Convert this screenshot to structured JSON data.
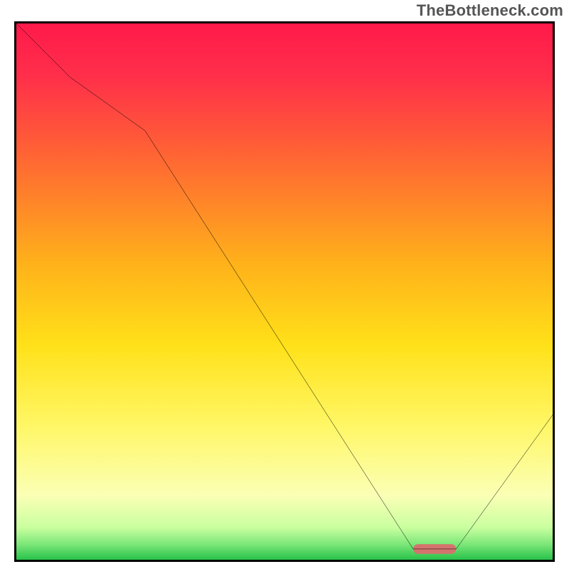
{
  "watermark": "TheBottleneck.com",
  "chart_data": {
    "type": "line",
    "title": "",
    "xlabel": "",
    "ylabel": "",
    "xlim": [
      0,
      100
    ],
    "ylim": [
      0,
      100
    ],
    "series": [
      {
        "name": "bottleneck-curve",
        "x": [
          0,
          10,
          24,
          74,
          78,
          82,
          100
        ],
        "y": [
          100,
          90,
          80,
          2,
          2,
          2,
          27
        ]
      }
    ],
    "marker": {
      "name": "optimal-range",
      "x_range": [
        74,
        82
      ],
      "y": 2,
      "color": "#d4736e"
    },
    "background_gradient": {
      "stops": [
        {
          "offset": 0.0,
          "color": "#ff1a4a"
        },
        {
          "offset": 0.1,
          "color": "#ff2f4a"
        },
        {
          "offset": 0.25,
          "color": "#ff6633"
        },
        {
          "offset": 0.45,
          "color": "#ffb21a"
        },
        {
          "offset": 0.6,
          "color": "#ffe119"
        },
        {
          "offset": 0.75,
          "color": "#fff766"
        },
        {
          "offset": 0.88,
          "color": "#fbffb5"
        },
        {
          "offset": 0.94,
          "color": "#c9ff9f"
        },
        {
          "offset": 0.97,
          "color": "#7fe87a"
        },
        {
          "offset": 1.0,
          "color": "#28c24a"
        }
      ]
    }
  }
}
